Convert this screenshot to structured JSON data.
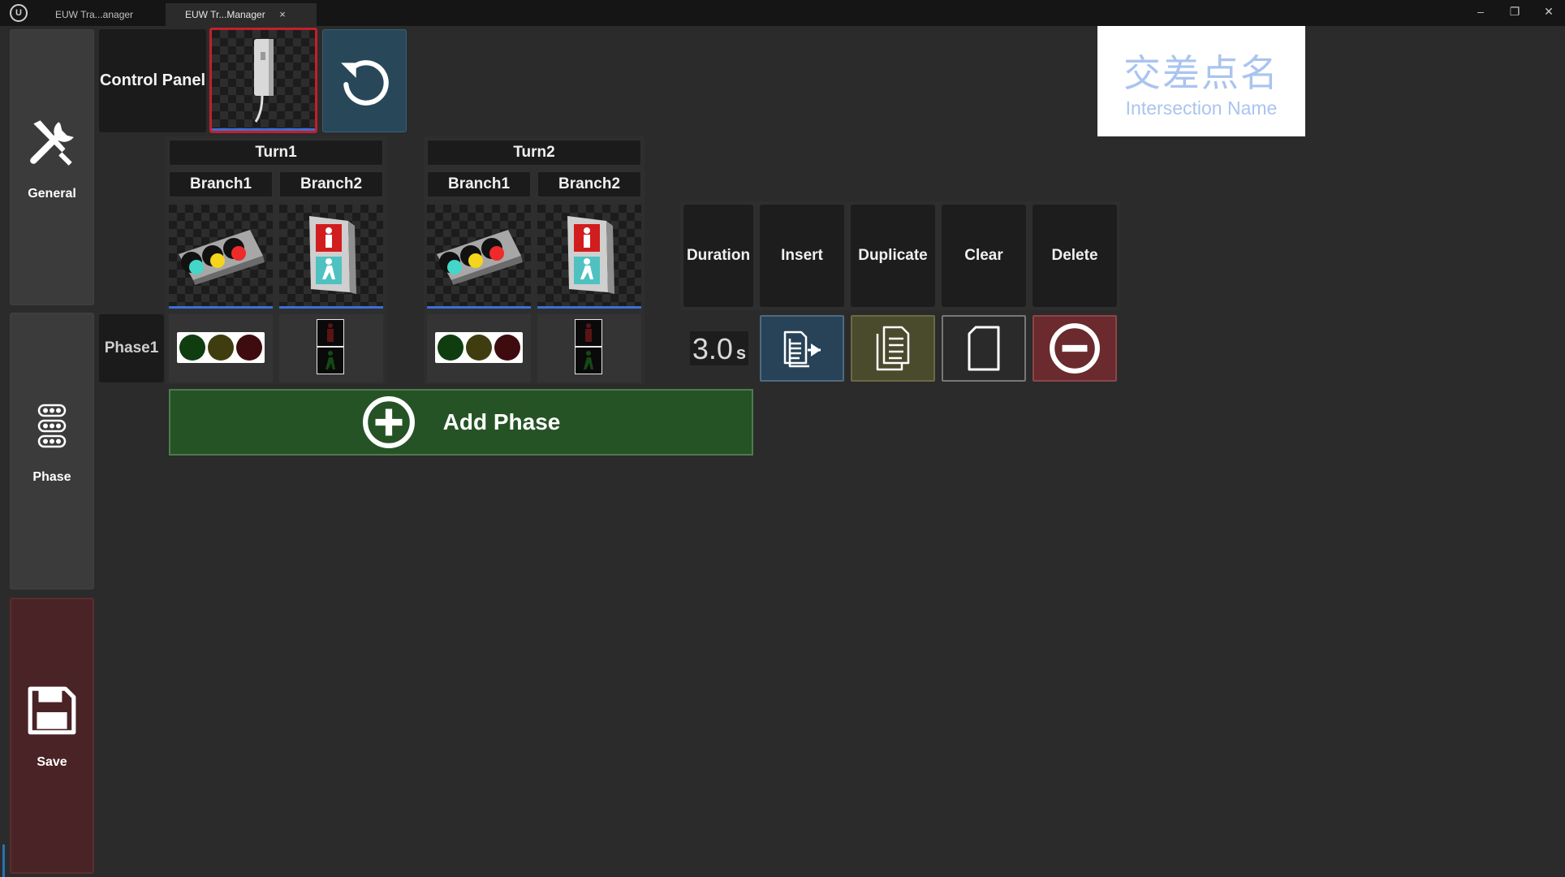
{
  "titlebar": {
    "tabs": [
      {
        "label": "EUW Tra...anager"
      },
      {
        "label": "EUW Tr...Manager",
        "close": "×"
      }
    ],
    "controls": {
      "minimize": "–",
      "restore": "❐",
      "close": "✕"
    }
  },
  "sidebar": {
    "items": [
      {
        "label": "General",
        "icon": "tools-icon"
      },
      {
        "label": "Phase",
        "icon": "phase-lights-icon"
      },
      {
        "label": "Save",
        "icon": "floppy-disk-icon"
      }
    ]
  },
  "control_panel": {
    "label": "Control Panel"
  },
  "intersection": {
    "name_zh": "交差点名",
    "name_en": "Intersection Name"
  },
  "turns": [
    {
      "label": "Turn1",
      "branches": [
        {
          "label": "Branch1",
          "type": "vehicle"
        },
        {
          "label": "Branch2",
          "type": "pedestrian"
        }
      ]
    },
    {
      "label": "Turn2",
      "branches": [
        {
          "label": "Branch1",
          "type": "vehicle"
        },
        {
          "label": "Branch2",
          "type": "pedestrian"
        }
      ]
    }
  ],
  "phases": [
    {
      "label": "Phase1",
      "duration": "3.0",
      "unit": "s"
    }
  ],
  "actions": {
    "headers": [
      "Duration",
      "Insert",
      "Duplicate",
      "Clear",
      "Delete"
    ]
  },
  "add_phase": {
    "label": "Add Phase"
  },
  "colors": {
    "accent_blue": "#3b6fd6",
    "add_green": "#255325",
    "save_red": "#4a2326",
    "delete_red": "#6b2a2d",
    "insert_blue": "#284357",
    "duplicate_olive": "#4a4a2d",
    "reset_teal": "#28485a",
    "lamp_green_off": "#0f3d10",
    "lamp_yellow_off": "#3f3d10",
    "lamp_red_off": "#3e0b0f"
  }
}
